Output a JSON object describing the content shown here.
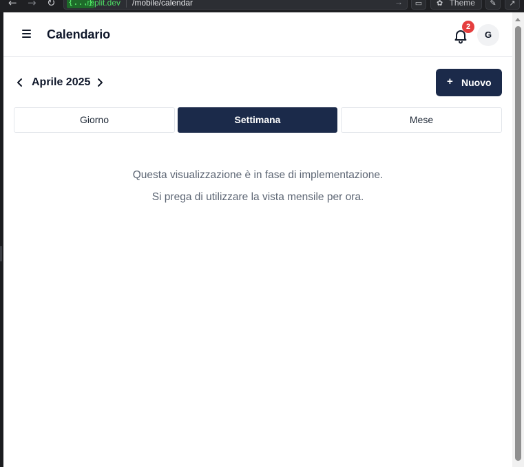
{
  "browser": {
    "url_badge": "{...}",
    "url_domain": ".replit.dev",
    "url_path": "/mobile/calendar",
    "theme_label": "Theme"
  },
  "header": {
    "title": "Calendario",
    "notification_count": "2",
    "avatar_initial": "G"
  },
  "calendar": {
    "month_label": "Aprile 2025",
    "new_button_plus": "+",
    "new_button_label": "Nuovo"
  },
  "tabs": [
    {
      "label": "Giorno",
      "active": false
    },
    {
      "label": "Settimana",
      "active": true
    },
    {
      "label": "Mese",
      "active": false
    }
  ],
  "message": {
    "line1": "Questa visualizzazione è in fase di implementazione.",
    "line2": "Si prega di utilizzare la vista mensile per ora."
  },
  "colors": {
    "primary": "#1b2a4a",
    "badge": "#e53e3e",
    "muted_text": "#5b6472"
  }
}
